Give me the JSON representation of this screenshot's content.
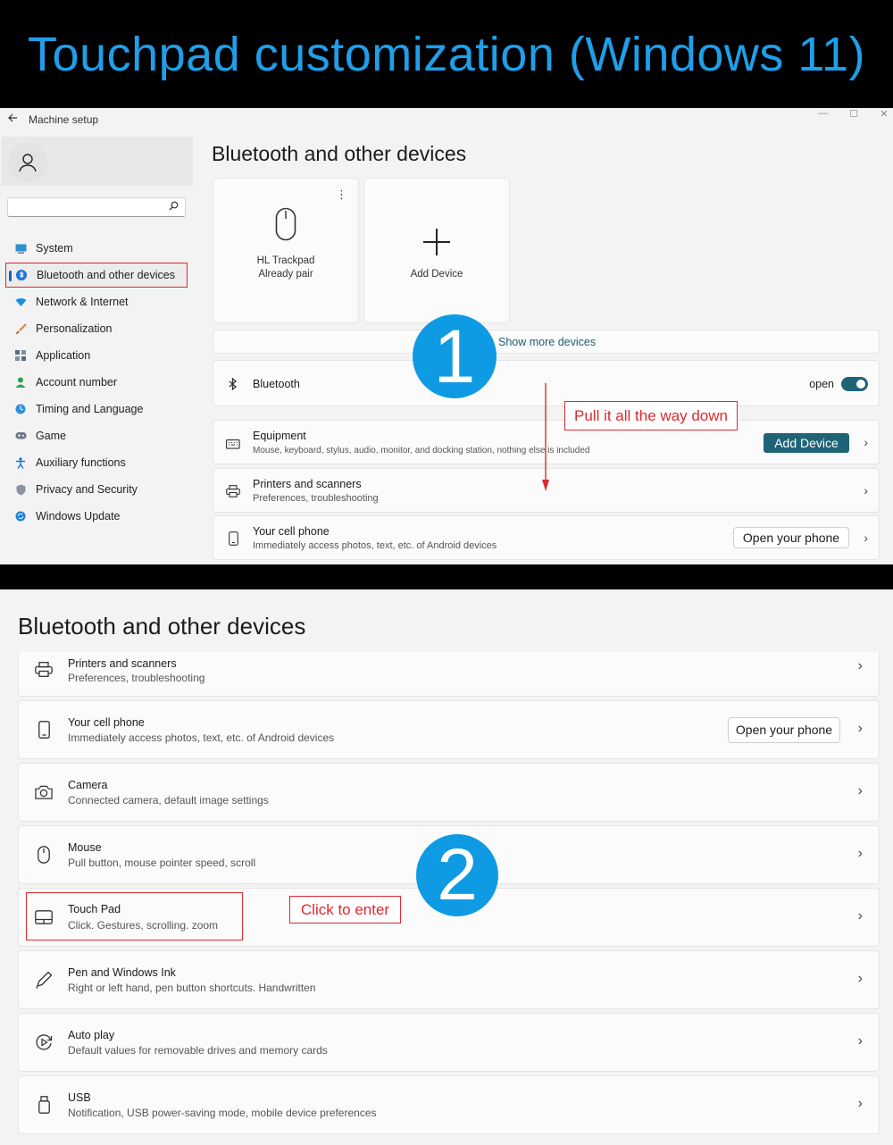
{
  "banner": {
    "title": "Touchpad customization (Windows 11)"
  },
  "window": {
    "title": "Machine setup"
  },
  "search": {
    "placeholder": ""
  },
  "nav": [
    {
      "label": "System",
      "icon": "monitor-icon"
    },
    {
      "label": "Bluetooth and other devices",
      "icon": "bluetooth-icon",
      "selected": true
    },
    {
      "label": "Network & Internet",
      "icon": "wifi-icon"
    },
    {
      "label": "Personalization",
      "icon": "brush-icon"
    },
    {
      "label": "Application",
      "icon": "apps-icon"
    },
    {
      "label": "Account number",
      "icon": "person-icon"
    },
    {
      "label": "Timing and Language",
      "icon": "globe-icon"
    },
    {
      "label": "Game",
      "icon": "gamepad-icon"
    },
    {
      "label": "Auxiliary functions",
      "icon": "accessibility-icon"
    },
    {
      "label": "Privacy and Security",
      "icon": "shield-icon"
    },
    {
      "label": "Windows Update",
      "icon": "update-icon"
    }
  ],
  "panel1": {
    "title": "Bluetooth and other devices",
    "device_card": {
      "name": "HL Trackpad",
      "status": "Already pair"
    },
    "add_card": {
      "label": "Add Device"
    },
    "show_more": "Show more devices",
    "bluetooth": {
      "label": "Bluetooth",
      "state": "open"
    },
    "equipment": {
      "title": "Equipment",
      "sub": "Mouse, keyboard, stylus, audio, monitor, and docking station, nothing else is included",
      "button": "Add Device"
    },
    "printers": {
      "title": "Printers and scanners",
      "sub": "Preferences, troubleshooting"
    },
    "phone": {
      "title": "Your cell phone",
      "sub": "Immediately access photos, text, etc. of Android devices",
      "button": "Open your phone"
    },
    "step": "1",
    "callout": "Pull it all the way down"
  },
  "panel2": {
    "title": "Bluetooth and other devices",
    "rows": [
      {
        "title": "Printers and scanners",
        "sub": "Preferences, troubleshooting"
      },
      {
        "title": "Your cell phone",
        "sub": "Immediately access photos, text, etc. of Android devices",
        "button": "Open your phone"
      },
      {
        "title": "Camera",
        "sub": "Connected camera, default image settings"
      },
      {
        "title": "Mouse",
        "sub": "Pull button, mouse pointer speed, scroll"
      },
      {
        "title": "Touch Pad",
        "sub": "Click. Gestures, scrolling. zoom"
      },
      {
        "title": "Pen and Windows Ink",
        "sub": "Right or left hand, pen button shortcuts. Handwritten"
      },
      {
        "title": "Auto play",
        "sub": "Default values for removable drives and memory cards"
      },
      {
        "title": "USB",
        "sub": "Notification, USB power-saving mode, mobile device preferences"
      }
    ],
    "step": "2",
    "callout": "Click to enter"
  },
  "colors": {
    "banner_text": "#1e9fea",
    "accent": "#1f6476",
    "badge": "#0e9be3",
    "highlight": "#e0282e"
  }
}
